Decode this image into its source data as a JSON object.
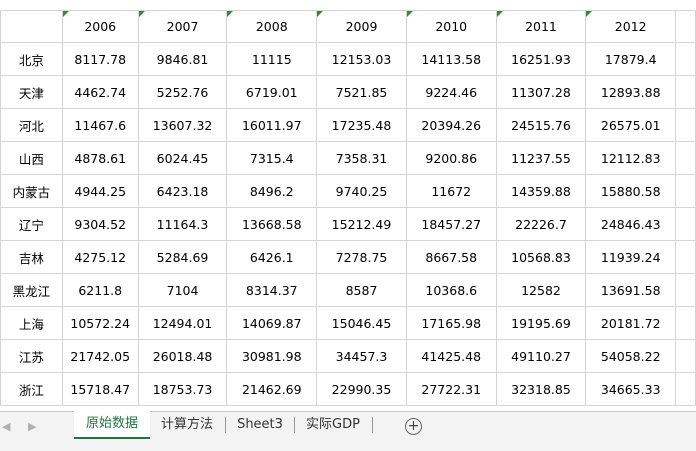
{
  "sheet": {
    "header": [
      "",
      "2006",
      "2007",
      "2008",
      "2009",
      "2010",
      "2011",
      "2012"
    ],
    "rows": [
      [
        "北京",
        "8117.78",
        "9846.81",
        "11115",
        "12153.03",
        "14113.58",
        "16251.93",
        "17879.4"
      ],
      [
        "天津",
        "4462.74",
        "5252.76",
        "6719.01",
        "7521.85",
        "9224.46",
        "11307.28",
        "12893.88"
      ],
      [
        "河北",
        "11467.6",
        "13607.32",
        "16011.97",
        "17235.48",
        "20394.26",
        "24515.76",
        "26575.01"
      ],
      [
        "山西",
        "4878.61",
        "6024.45",
        "7315.4",
        "7358.31",
        "9200.86",
        "11237.55",
        "12112.83"
      ],
      [
        "内蒙古",
        "4944.25",
        "6423.18",
        "8496.2",
        "9740.25",
        "11672",
        "14359.88",
        "15880.58"
      ],
      [
        "辽宁",
        "9304.52",
        "11164.3",
        "13668.58",
        "15212.49",
        "18457.27",
        "22226.7",
        "24846.43"
      ],
      [
        "吉林",
        "4275.12",
        "5284.69",
        "6426.1",
        "7278.75",
        "8667.58",
        "10568.83",
        "11939.24"
      ],
      [
        "黑龙江",
        "6211.8",
        "7104",
        "8314.37",
        "8587",
        "10368.6",
        "12582",
        "13691.58"
      ],
      [
        "上海",
        "10572.24",
        "12494.01",
        "14069.87",
        "15046.45",
        "17165.98",
        "19195.69",
        "20181.72"
      ],
      [
        "江苏",
        "21742.05",
        "26018.48",
        "30981.98",
        "34457.3",
        "41425.48",
        "49110.27",
        "54058.22"
      ],
      [
        "浙江",
        "15718.47",
        "18753.73",
        "21462.69",
        "22990.35",
        "27722.31",
        "32318.85",
        "34665.33"
      ]
    ]
  },
  "tabs": [
    "原始数据",
    "计算方法",
    "Sheet3",
    "实际GDP"
  ],
  "active_tab": "原始数据",
  "nav": {
    "prev": "◀",
    "next": "▶",
    "add": "+"
  },
  "colors": {
    "accent": "#217346",
    "error_triangle": "#2e8b3a",
    "gridline": "#d4d4d4"
  }
}
